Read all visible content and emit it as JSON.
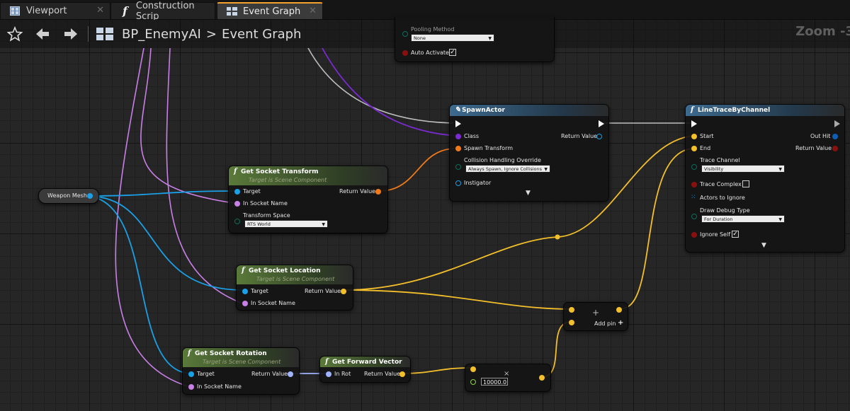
{
  "tabs": [
    {
      "label": "Viewport",
      "icon": "viewport-icon"
    },
    {
      "label": "Construction Scrip",
      "icon": "function-icon"
    },
    {
      "label": "Event Graph",
      "icon": "graph-icon",
      "active": true
    }
  ],
  "breadcrumb": {
    "blueprint": "BP_EnemyAI",
    "separator": ">",
    "graph": "Event Graph"
  },
  "zoom_label": "Zoom -3",
  "nodes": {
    "pooling": {
      "pooling_method_label": "Pooling Method",
      "pooling_method_value": "None",
      "auto_activate_label": "Auto Activate",
      "auto_activate_checked": true
    },
    "weapon_mesh": {
      "label": "Weapon Mesh"
    },
    "get_socket_transform": {
      "title": "Get Socket Transform",
      "subtitle": "Target is Scene Component",
      "target": "Target",
      "in_socket_name": "In Socket Name",
      "transform_space": "Transform Space",
      "transform_space_value": "RTS World",
      "return_value": "Return Value"
    },
    "spawn_actor": {
      "title": "SpawnActor",
      "class": "Class",
      "spawn_transform": "Spawn Transform",
      "collision_label": "Collision Handling Override",
      "collision_value": "Always Spawn, Ignore Collisions",
      "instigator": "Instigator",
      "return_value": "Return Value"
    },
    "line_trace": {
      "title": "LineTraceByChannel",
      "start": "Start",
      "end": "End",
      "trace_channel": "Trace Channel",
      "trace_channel_value": "Visibility",
      "trace_complex": "Trace Complex",
      "actors_to_ignore": "Actors to Ignore",
      "draw_debug_type": "Draw Debug Type",
      "draw_debug_value": "For Duration",
      "ignore_self": "Ignore Self",
      "ignore_self_checked": true,
      "out_hit": "Out Hit",
      "return_value": "Return Value"
    },
    "get_socket_location": {
      "title": "Get Socket Location",
      "subtitle": "Target is Scene Component",
      "target": "Target",
      "in_socket_name": "In Socket Name",
      "return_value": "Return Value"
    },
    "add_node": {
      "add_pin": "Add pin"
    },
    "get_socket_rotation": {
      "title": "Get Socket Rotation",
      "subtitle": "Target is Scene Component",
      "target": "Target",
      "in_socket_name": "In Socket Name",
      "return_value": "Return Value"
    },
    "get_forward_vector": {
      "title": "Get Forward Vector",
      "in_rot": "In Rot",
      "return_value": "Return Value"
    },
    "multiply_node": {
      "value": "10000.0"
    }
  },
  "colors": {
    "exec": "#ffffff",
    "object": "#1aa0e6",
    "name": "#c87fe6",
    "transform": "#f07a1a",
    "vector": "#f3bf2a",
    "rotator": "#9fb3ff",
    "class": "#7b2bd1",
    "bool": "#8a1010",
    "float": "#8fd34a",
    "byte": "#0b6e5a",
    "struct_out": "#0c5fb5",
    "tab_accent": "#f3a12a"
  }
}
